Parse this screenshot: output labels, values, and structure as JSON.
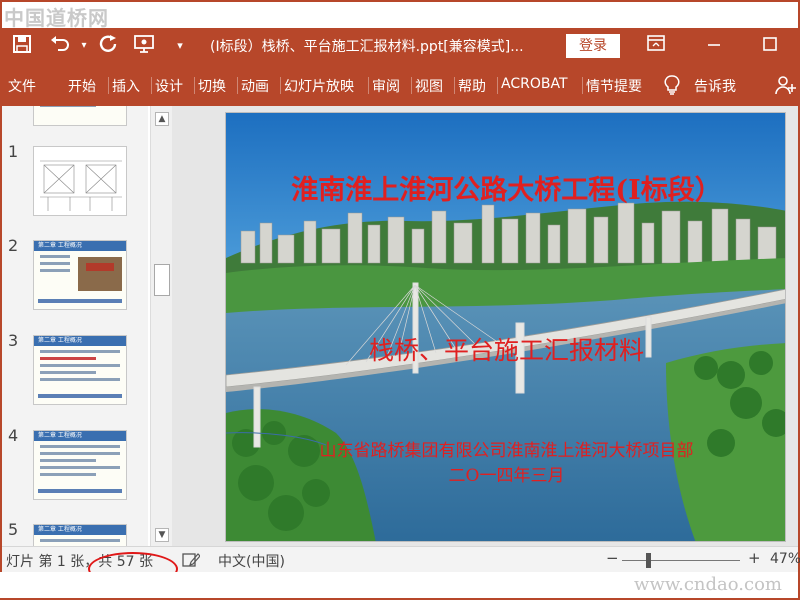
{
  "watermark": {
    "top": "中国道桥网",
    "bottom": "www.cndao.com"
  },
  "titlebar": {
    "document_title": "(I标段）栈桥、平台施工汇报材料.ppt[兼容模式]...",
    "login_label": "登录",
    "icons": [
      "save-icon",
      "undo-icon",
      "redo-icon",
      "present-icon",
      "customize-icon",
      "ribbon-display-icon",
      "minimize-icon",
      "restore-icon"
    ]
  },
  "ribbon": {
    "tabs": [
      "文件",
      "开始",
      "插入",
      "设计",
      "切换",
      "动画",
      "幻灯片放映",
      "审阅",
      "视图",
      "帮助",
      "ACROBAT",
      "情节提要"
    ],
    "tell_me": "告诉我"
  },
  "thumbnails": [
    {
      "number": "",
      "kind": "partial"
    },
    {
      "number": "1",
      "kind": "drawing"
    },
    {
      "number": "2",
      "kind": "photo",
      "heading": "第二章  工程概况"
    },
    {
      "number": "3",
      "kind": "text",
      "heading": "第二章  工程概况"
    },
    {
      "number": "4",
      "kind": "text",
      "heading": "第二章  工程概况"
    },
    {
      "number": "5",
      "kind": "text",
      "heading": "第二章  工程概况"
    }
  ],
  "slide": {
    "title": "淮南淮上淮河公路大桥工程(I标段）",
    "subtitle": "栈桥、平台施工汇报材料",
    "company": "山东省路桥集团有限公司淮南淮上淮河大桥项目部",
    "date": "二O一四年三月"
  },
  "statusbar": {
    "slide_info": "灯片 第 1 张，共 57 张",
    "language": "中文(中国)",
    "zoom_minus": "−",
    "zoom_plus": "+",
    "zoom": "47%",
    "zoom_level_fraction": 0.2
  },
  "colors": {
    "accent": "#b7472a",
    "slide_text": "#e02020",
    "highlight_oval": "#e01818"
  }
}
